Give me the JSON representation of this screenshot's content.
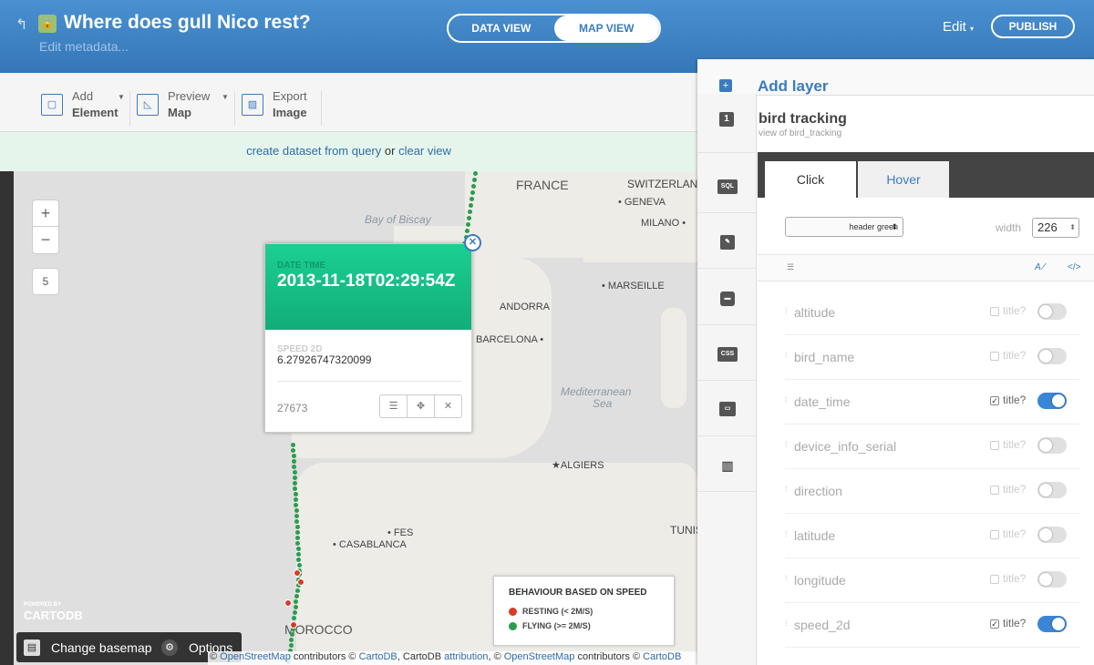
{
  "header": {
    "back_icon": "back-arrow-icon",
    "lock_icon": "lock-icon",
    "title": "Where does gull Nico rest?",
    "metadata_link": "Edit metadata...",
    "data_view": "DATA VIEW",
    "map_view": "MAP VIEW",
    "edit": "Edit",
    "publish": "PUBLISH"
  },
  "toolbar": {
    "add_element": [
      "Add",
      "Element"
    ],
    "preview_map": [
      "Preview",
      "Map"
    ],
    "export_image": [
      "Export",
      "Image"
    ]
  },
  "query_bar": {
    "create": "create dataset from query",
    "or": "or",
    "clear": "clear view"
  },
  "map": {
    "zoom_in": "+",
    "zoom_out": "−",
    "zoom_level": "5",
    "labels": {
      "france": "FRANCE",
      "switzerland": "SWITZERLAND",
      "geneva": "GENEVA",
      "milano": "MILANO",
      "biscay": "Bay of Biscay",
      "marseille": "MARSEILLE",
      "andorra": "ANDORRA",
      "barcelona": "BARCELONA",
      "med1": "Mediterranean",
      "med2": "Sea",
      "algiers": "ALGIERS",
      "tunis": "TUNIS",
      "fes": "FES",
      "casablanca": "CASABLANCA",
      "morocco": "MOROCCO"
    },
    "popup": {
      "date_label": "DATE TIME",
      "date_value": "2013-11-18T02:29:54Z",
      "speed_label": "SPEED 2D",
      "speed_value": "6.27926747320099",
      "cartodb_id": "27673"
    },
    "legend": {
      "title": "BEHAVIOUR BASED ON SPEED",
      "items": [
        {
          "label": "RESTING (< 2M/S)",
          "color": "#d83b2a"
        },
        {
          "label": "FLYING (>= 2M/S)",
          "color": "#2a9d4f"
        }
      ]
    },
    "powered_by": "POWERED BY",
    "logo": "CARTODB",
    "change_basemap": "Change basemap",
    "options": "Options",
    "attribution": {
      "c1": "©",
      "osm1": "OpenStreetMap",
      "t1": "contributors ©",
      "cartodb1": "CartoDB",
      "t2": ", CartoDB",
      "attribution": "attribution",
      "t3": ", ©",
      "osm2": "OpenStreetMap",
      "t4": "contributors ©",
      "cartodb2": "CartoDB"
    }
  },
  "panel": {
    "add_layer": "Add layer",
    "layer_number": "1",
    "layer_name": "bird tracking",
    "layer_sub": "view of bird_tracking",
    "tabs": {
      "click": "Click",
      "hover": "Hover"
    },
    "template": "header green",
    "width_label": "width",
    "width_value": "226",
    "fields": [
      {
        "name": "altitude",
        "title": "title?",
        "checked": false
      },
      {
        "name": "bird_name",
        "title": "title?",
        "checked": false
      },
      {
        "name": "date_time",
        "title": "title?",
        "checked": true
      },
      {
        "name": "device_info_serial",
        "title": "title?",
        "checked": false
      },
      {
        "name": "direction",
        "title": "title?",
        "checked": false
      },
      {
        "name": "latitude",
        "title": "title?",
        "checked": false
      },
      {
        "name": "longitude",
        "title": "title?",
        "checked": false
      },
      {
        "name": "speed_2d",
        "title": "title?",
        "checked": true
      }
    ]
  },
  "colors": {
    "header_blue": "#3b83c4",
    "popup_green": "#19c68d",
    "accent": "#3a7cbf"
  }
}
